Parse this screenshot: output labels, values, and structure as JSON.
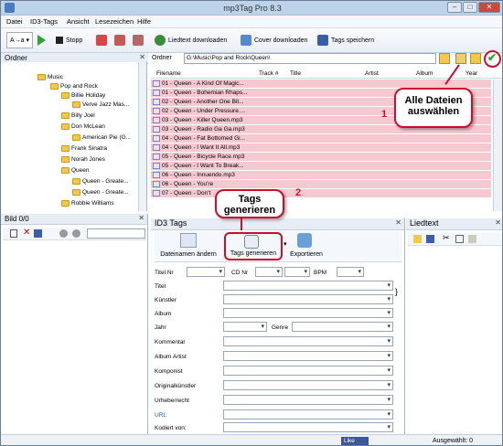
{
  "window": {
    "title": "mp3Tag Pro 8.3",
    "controls": [
      "–",
      "□",
      "✕"
    ]
  },
  "menu": [
    "Datei",
    "ID3-Tags",
    "Ansicht",
    "Lesezeichen",
    "Hilfe"
  ],
  "toolbar": {
    "stop": "Stopp",
    "lyrics": "Liedtext downloaden",
    "cover": "Cover downloaden",
    "save": "Tags speichern"
  },
  "folders_panel": {
    "title": "Ordner",
    "items": [
      {
        "label": "Music",
        "lvl": 2
      },
      {
        "label": "Pop and Rock",
        "lvl": 3
      },
      {
        "label": "Billie Holiday",
        "lvl": 4
      },
      {
        "label": "Verve Jazz Mas...",
        "lvl": 5
      },
      {
        "label": "Billy Joel",
        "lvl": 4
      },
      {
        "label": "Don McLean",
        "lvl": 4
      },
      {
        "label": "American Pie (G...",
        "lvl": 5
      },
      {
        "label": "Frank Sinatra",
        "lvl": 4
      },
      {
        "label": "Norah Jones",
        "lvl": 4
      },
      {
        "label": "Queen",
        "lvl": 4
      },
      {
        "label": "Queen - Greate...",
        "lvl": 5
      },
      {
        "label": "Queen - Greate...",
        "lvl": 5
      },
      {
        "label": "Robbie Williams",
        "lvl": 4
      }
    ]
  },
  "path_bar": {
    "label": "Ordner",
    "value": "G:\\Music\\Pop and Rock\\Queen\\"
  },
  "file_columns": [
    "Filename",
    "Track #",
    "Title",
    "Artist",
    "Album",
    "Year"
  ],
  "files": [
    "01 - Queen - A Kind Of Magic...",
    "01 - Queen - Bohemian Rhaps...",
    "02 - Queen - Another One Bit...",
    "02 - Queen - Under Pressure....",
    "03 - Queen - Killer Queen.mp3",
    "03 - Queen - Radio Ga Ga.mp3",
    "04 - Queen - Fat Bottomed Gi...",
    "04 - Queen - I Want It All.mp3",
    "05 - Queen - Bicycle Race.mp3",
    "05 - Queen - I Want To Break...",
    "06 - Queen - Innuendo.mp3",
    "06 - Queen - You're",
    "07 - Queen - Don't"
  ],
  "picture_panel": {
    "title": "Bild 0/0"
  },
  "id3_panel": {
    "title": "ID3 Tags",
    "btn_filenames": "Dateinamen ändern",
    "btn_generate": "Tags generieren",
    "btn_export": "Exportieren",
    "track_label": "Titel Nr",
    "cd_label": "CD Nr",
    "bpm_label": "BPM",
    "fields": [
      "Titel",
      "Künstler",
      "Album",
      "Jahr",
      "Kommentar",
      "Album Artist",
      "Komponist",
      "Originalkünstler",
      "Urheberrecht",
      "URL",
      "Kodiert von:"
    ],
    "genre_label": "Genre"
  },
  "lyrics_panel": {
    "title": "Liedtext"
  },
  "status": {
    "like": "Like",
    "selected": "Ausgewählt: 0"
  },
  "callouts": {
    "select_all": "Alle Dateien auswählen",
    "generate": "Tags generieren",
    "num1": "1",
    "num2": "2"
  }
}
